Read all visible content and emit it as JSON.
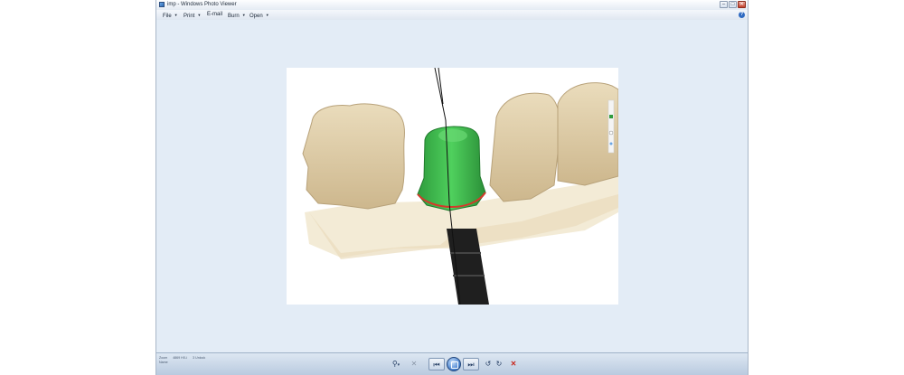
{
  "window": {
    "title": "imp - Windows Photo Viewer",
    "controls": {
      "minimize": "–",
      "maximize": "□",
      "close": "✕"
    }
  },
  "menu": {
    "file": "File",
    "print": "Print",
    "email": "E-mail",
    "burn": "Burn",
    "open": "Open",
    "help_icon": "?"
  },
  "bottom_info": {
    "line1": [
      "Zoom",
      "4869 HX-i",
      "3 Unlock"
    ],
    "line2": [
      "Name"
    ]
  },
  "toolbar": {
    "zoom_icon": "⚲",
    "zoom_arrow": "▾",
    "fit_icon": "✕",
    "prev_icon": "⏮",
    "next_icon": "⏭",
    "rotate_ccw_icon": "↺",
    "rotate_cw_icon": "↻",
    "delete_icon": "✕"
  },
  "colors": {
    "window_bg": "#e3ecf6",
    "tooth": "#e6d6b2",
    "crown": "#3fbf4f",
    "margin_line": "#d33a2b",
    "implant": "#202020"
  }
}
